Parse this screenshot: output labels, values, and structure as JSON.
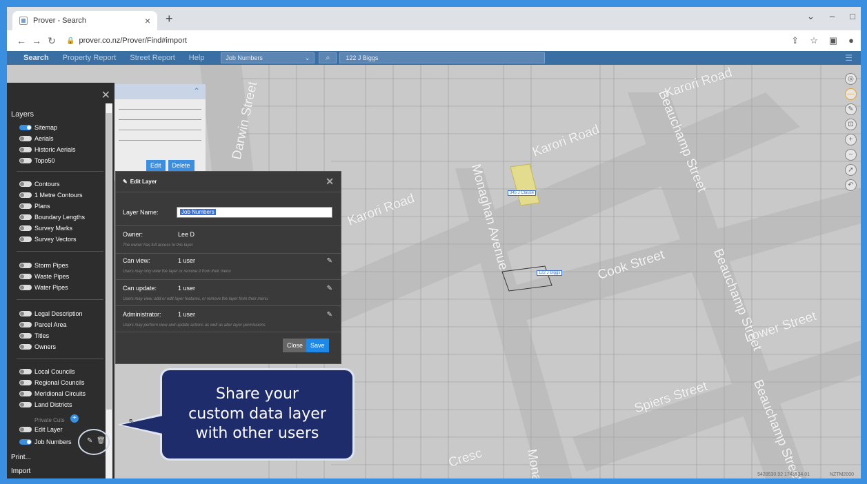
{
  "browser": {
    "tab_title": "Prover - Search",
    "tab_close": "×",
    "new_tab": "+",
    "url": "prover.co.nz/Prover/Find#import",
    "win_min": "–",
    "win_max": "□",
    "win_more": "⌄"
  },
  "appbar": {
    "menu": [
      "Search",
      "Property Report",
      "Street Report",
      "Help"
    ],
    "layer_select": "Job Numbers",
    "search_value": "122 J Biggs"
  },
  "layers_panel": {
    "heading": "Layers",
    "items": [
      {
        "label": "Sitemap",
        "on": true
      },
      {
        "label": "Aerials",
        "on": false
      },
      {
        "label": "Historic Aerials",
        "on": false
      },
      {
        "label": "Topo50",
        "on": false
      },
      {
        "label": "Contours",
        "on": false
      },
      {
        "label": "1 Metre Contours",
        "on": false
      },
      {
        "label": "Plans",
        "on": false
      },
      {
        "label": "Boundary Lengths",
        "on": false
      },
      {
        "label": "Survey Marks",
        "on": false
      },
      {
        "label": "Survey Vectors",
        "on": false
      },
      {
        "label": "Storm Pipes",
        "on": false
      },
      {
        "label": "Waste Pipes",
        "on": false
      },
      {
        "label": "Water Pipes",
        "on": false
      },
      {
        "label": "Legal Description",
        "on": false
      },
      {
        "label": "Parcel Area",
        "on": false
      },
      {
        "label": "Titles",
        "on": false
      },
      {
        "label": "Owners",
        "on": false
      },
      {
        "label": "Local Councils",
        "on": false
      },
      {
        "label": "Regional Councils",
        "on": false
      },
      {
        "label": "Meridional Circuits",
        "on": false
      },
      {
        "label": "Land Districts",
        "on": false
      },
      {
        "label": "Edit Layer",
        "on": false
      },
      {
        "label": "Job Numbers",
        "on": true
      }
    ],
    "private_cuts": "Private Cuts",
    "print": "Print...",
    "import": "Import"
  },
  "results": {
    "edit": "Edit",
    "delete": "Delete"
  },
  "dialog": {
    "title": "Edit Layer",
    "layer_name_label": "Layer Name:",
    "layer_name_value": "Job Numbers",
    "owner_label": "Owner:",
    "owner_value": "Lee D",
    "owner_hint": "The owner has full access to this layer",
    "can_view_label": "Can view:",
    "can_view_value": "1 user",
    "can_view_hint": "Users may only view the layer or remove it from their menu",
    "can_update_label": "Can update:",
    "can_update_value": "1 user",
    "can_update_hint": "Users may view, add or edit layer features, or remove the layer from their menu",
    "admin_label": "Administrator:",
    "admin_value": "1 user",
    "admin_hint": "Users may perform view and update actions as well as alter layer permissions",
    "close": "Close",
    "save": "Save"
  },
  "callout": {
    "line1": "Share your",
    "line2": "custom data layer",
    "line3": "with other users"
  },
  "map": {
    "streets": [
      "Darwin Street",
      "Karori Road",
      "Karori Road",
      "Karori Road",
      "Monaghan Avenue",
      "Beauchamp Street",
      "Cook Street",
      "Beauchamp Street",
      "Lower Street",
      "Spiers Street",
      "Beauchamp Street",
      "Cresc",
      "Mona"
    ],
    "tag_a": "345 J Clause",
    "tag_b": "122 J Biggs",
    "coords": "5428530.92 1745534.01",
    "crs": "NZTM2000"
  },
  "colors": {
    "accent": "#1f88e5",
    "callout_bg": "#1f2c6b",
    "panel_bg": "#2d2d2d"
  }
}
